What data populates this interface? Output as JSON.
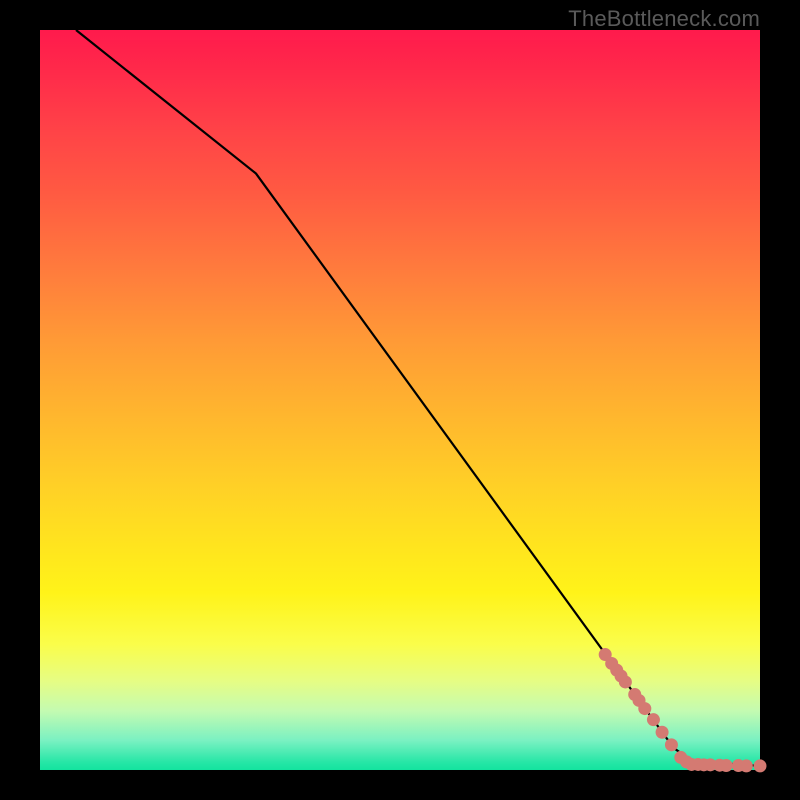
{
  "watermark": "TheBottleneck.com",
  "chart_data": {
    "type": "line",
    "title": "",
    "xlabel": "",
    "ylabel": "",
    "xlim": [
      0,
      100
    ],
    "ylim": [
      0,
      100
    ],
    "grid": false,
    "line": {
      "name": "curve",
      "color": "#000000",
      "points_xy": [
        [
          5,
          100
        ],
        [
          30,
          80.6
        ],
        [
          88,
          3
        ],
        [
          90.5,
          1.2
        ],
        [
          100,
          0.55
        ]
      ]
    },
    "scatter": {
      "name": "data-points",
      "color": "#d47a72",
      "radius": 6.5,
      "points_xy": [
        [
          78.5,
          15.6
        ],
        [
          79.4,
          14.4
        ],
        [
          80.1,
          13.5
        ],
        [
          80.7,
          12.7
        ],
        [
          81.3,
          11.9
        ],
        [
          82.6,
          10.2
        ],
        [
          83.2,
          9.4
        ],
        [
          84.0,
          8.3
        ],
        [
          85.2,
          6.8
        ],
        [
          86.4,
          5.1
        ],
        [
          87.7,
          3.4
        ],
        [
          89.0,
          1.7
        ],
        [
          89.8,
          1.1
        ],
        [
          90.5,
          0.75
        ],
        [
          91.4,
          0.75
        ],
        [
          92.2,
          0.7
        ],
        [
          93.1,
          0.7
        ],
        [
          94.4,
          0.65
        ],
        [
          95.3,
          0.6
        ],
        [
          97.0,
          0.6
        ],
        [
          98.1,
          0.55
        ],
        [
          100.0,
          0.55
        ]
      ]
    }
  }
}
